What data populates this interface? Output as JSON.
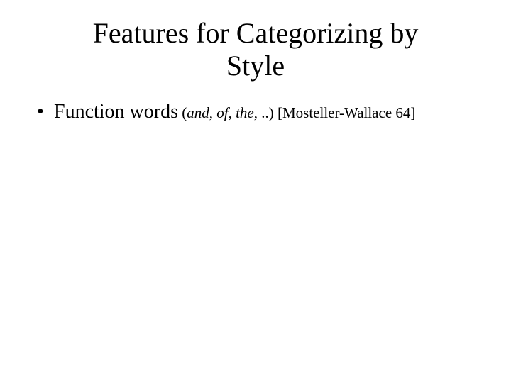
{
  "title_line1": "Features for Categorizing by",
  "title_line2": "Style",
  "bullet1": {
    "lead": "Function words",
    "paren_open": " (",
    "examples": "and, of, the",
    "dots": ", ..",
    "paren_close": ") ",
    "citation": "[Mosteller-Wallace 64]"
  }
}
